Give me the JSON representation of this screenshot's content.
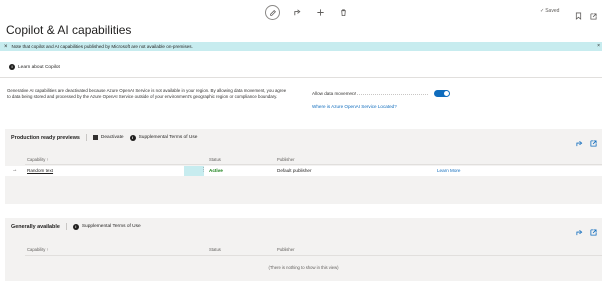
{
  "toolbar": {
    "saved_label": "Saved"
  },
  "page": {
    "title": "Copilot & AI capabilities"
  },
  "banner": {
    "text": "Note that copilot and AI capabilities published by Microsoft are not available on-premises."
  },
  "learn": {
    "label": "Learn about Copilot"
  },
  "settings": {
    "description": "Generative AI capabilities are deactivated because Azure OpenAI Service is not available in your region. By allowing data movement, you agree to data being stored and processed by the Azure OpenAI Service outside of your environment's geographic region or compliance boundary.",
    "allow_label": "Allow data movement",
    "allow_on": true,
    "where_link": "Where is Azure OpenAI Service Located?"
  },
  "production": {
    "title": "Production ready previews",
    "actions": [
      "Deactivate",
      "Supplemental Terms of Use"
    ],
    "columns": [
      "Capability ↑",
      "Status",
      "Publisher"
    ],
    "rows": [
      {
        "capability": "Random text",
        "status": "Active",
        "publisher": "Default publisher",
        "link": "Learn More"
      }
    ]
  },
  "general": {
    "title": "Generally available",
    "actions": [
      "Supplemental Terms of Use"
    ],
    "columns": [
      "Capability ↑",
      "Status",
      "Publisher"
    ],
    "empty_text": "(There is nothing to show in this view)"
  },
  "colors": {
    "accent": "#0f6cbd",
    "banner": "#c7ecef",
    "active": "#107c10",
    "section_bg": "#f3f2f1"
  }
}
